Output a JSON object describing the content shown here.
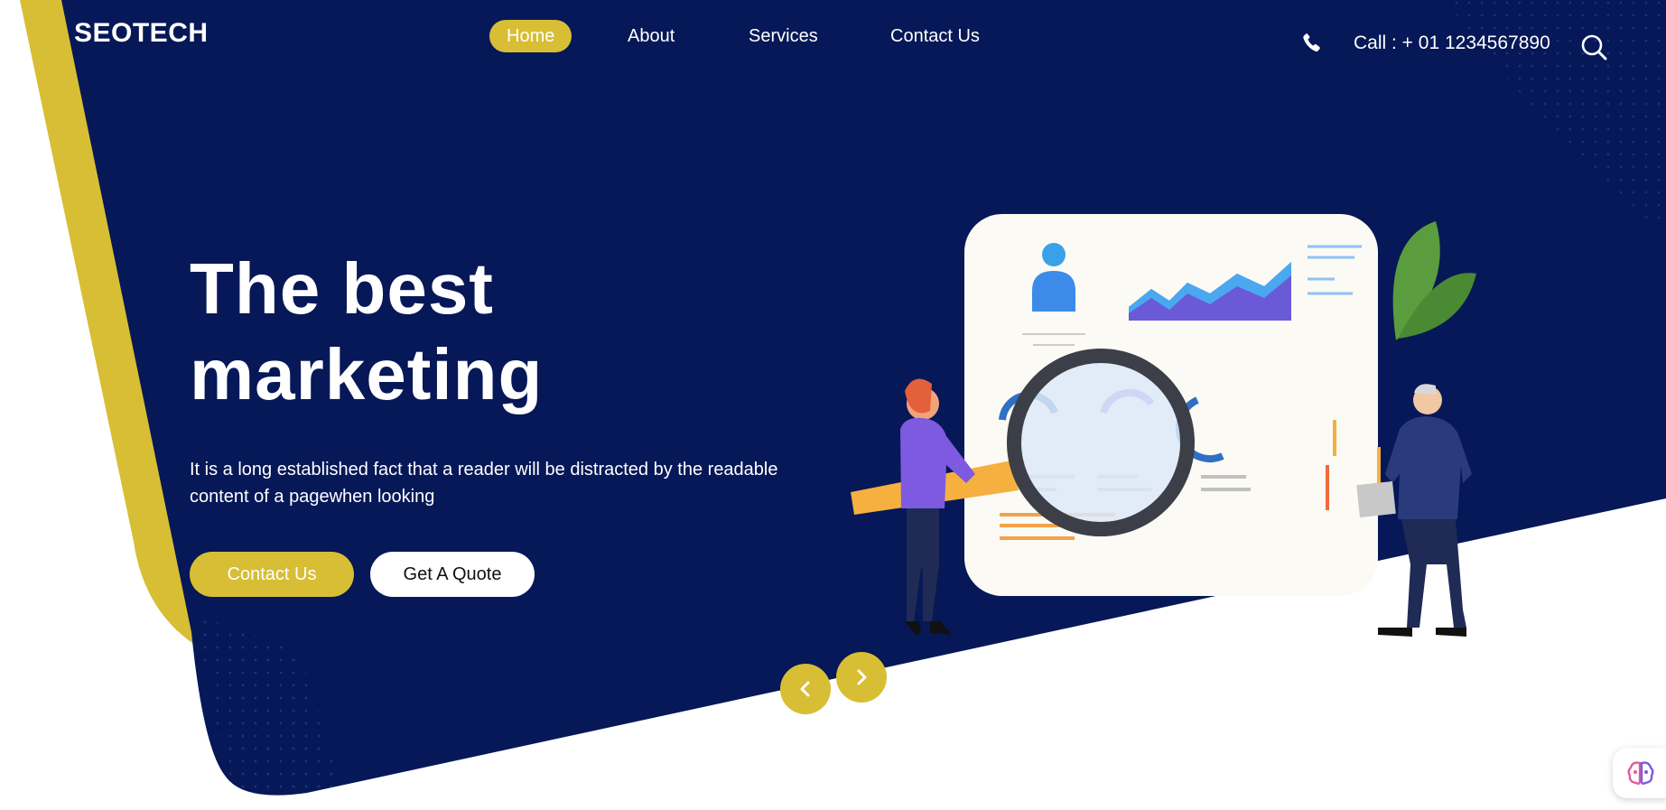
{
  "colors": {
    "navy": "#061857",
    "accent": "#d7be34",
    "white": "#ffffff"
  },
  "brand": {
    "name": "SEOTECH"
  },
  "nav": {
    "items": [
      {
        "label": "Home",
        "active": true
      },
      {
        "label": "About",
        "active": false
      },
      {
        "label": "Services",
        "active": false
      },
      {
        "label": "Contact Us",
        "active": false
      }
    ]
  },
  "header": {
    "call_text": "Call : + 01 1234567890",
    "icons": [
      "phone-icon",
      "search-icon"
    ]
  },
  "hero": {
    "title_line1": "The best",
    "title_line2": "marketing",
    "description": "It is a long established fact that a reader will be distracted by the readable content of a pagewhen looking",
    "contact_button": "Contact Us",
    "quote_button": "Get A Quote"
  },
  "carousel": {
    "icons": [
      "chevron-left-icon",
      "chevron-right-icon"
    ]
  },
  "widget": {
    "icon": "brain-icon"
  }
}
